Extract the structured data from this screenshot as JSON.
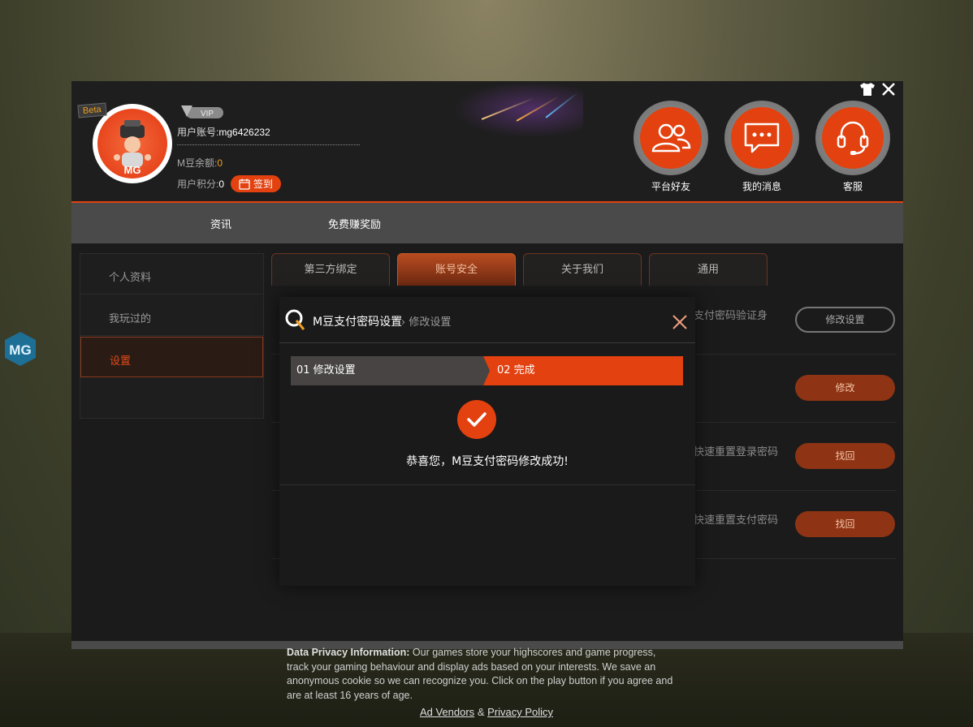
{
  "header": {
    "beta_badge": "Beta",
    "vip_badge": "VIP",
    "account_label": "用户账号:",
    "account_value": "mg6426232",
    "balance_label": "M豆余额:",
    "balance_value": "0",
    "points_label": "用户积分:",
    "points_value": "0",
    "signin_label": "签到",
    "circles": [
      {
        "label": "平台好友",
        "icon": "friends-icon"
      },
      {
        "label": "我的消息",
        "icon": "message-icon"
      },
      {
        "label": "客服",
        "icon": "headset-icon"
      }
    ],
    "top_icons": [
      "shirt-icon",
      "close-icon"
    ]
  },
  "nav": {
    "items": [
      "资讯",
      "免费赚奖励"
    ]
  },
  "left_menu": {
    "items": [
      "个人资料",
      "我玩过的",
      "设置"
    ],
    "active_index": 2
  },
  "tabs": {
    "items": [
      "第三方绑定",
      "账号安全",
      "关于我们",
      "通用"
    ],
    "active_index": 1
  },
  "rows": [
    {
      "text": "支付密码验证身",
      "button": "修改设置"
    },
    {
      "text": "",
      "button": "修改"
    },
    {
      "text": "快速重置登录密码",
      "button": "找回"
    },
    {
      "text": "快速重置支付密码",
      "button": "找回"
    }
  ],
  "dialog": {
    "title": "M豆支付密码设置",
    "breadcrumb": "› 修改设置",
    "step1": "01 修改设置",
    "step2": "02 完成",
    "success_message": "恭喜您，M豆支付密码修改成功!"
  },
  "privacy": {
    "heading": "Data Privacy Information:",
    "body": "Our games store your highscores and game progress, track your gaming behaviour and display ads based on your interests. We save an anonymous cookie so we can recognize you. Click on the play button if you agree and are at least 16 years of age.",
    "link1": "Ad Vendors",
    "separator": "&",
    "link2": "Privacy Policy"
  },
  "colors": {
    "accent": "#e3410f",
    "panel": "#1b1b1b",
    "nav": "#4b4a4a"
  }
}
